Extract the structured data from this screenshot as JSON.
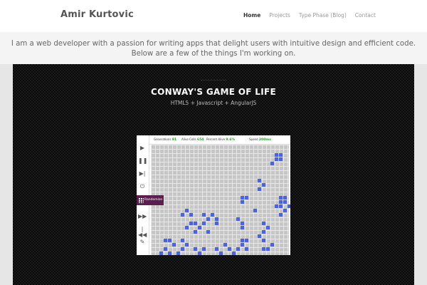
{
  "header": {
    "brand": "Amir Kurtovic",
    "nav": [
      {
        "label": "Home",
        "active": true
      },
      {
        "label": "Projects",
        "active": false
      },
      {
        "label": "Type Phase (Blog)",
        "active": false
      },
      {
        "label": "Contact",
        "active": false
      }
    ]
  },
  "intro": {
    "text": "I am a web developer with a passion for writing apps that delight users with intuitive design and efficient code. Below are a few of the things I'm working on."
  },
  "project": {
    "title": "CONWAY'S GAME OF LIFE",
    "subtitle": "HTML5 + Javascript + AngularJS",
    "screenshot": {
      "stats": [
        {
          "label": "Generations",
          "value": "91"
        },
        {
          "label": "Alive Cells",
          "value": "654"
        },
        {
          "label": "Percent Alive",
          "value": "9.6%"
        },
        {
          "label": "Speed",
          "value": "200ms"
        }
      ],
      "randomize_label": "Randomize",
      "cell_color": "#4a63e0"
    }
  },
  "colors": {
    "header_bg": "#ffffff",
    "intro_bg": "#f4f4f4",
    "project_bg": "#0b0b0b",
    "randomize_bg": "#5b1f4f"
  }
}
